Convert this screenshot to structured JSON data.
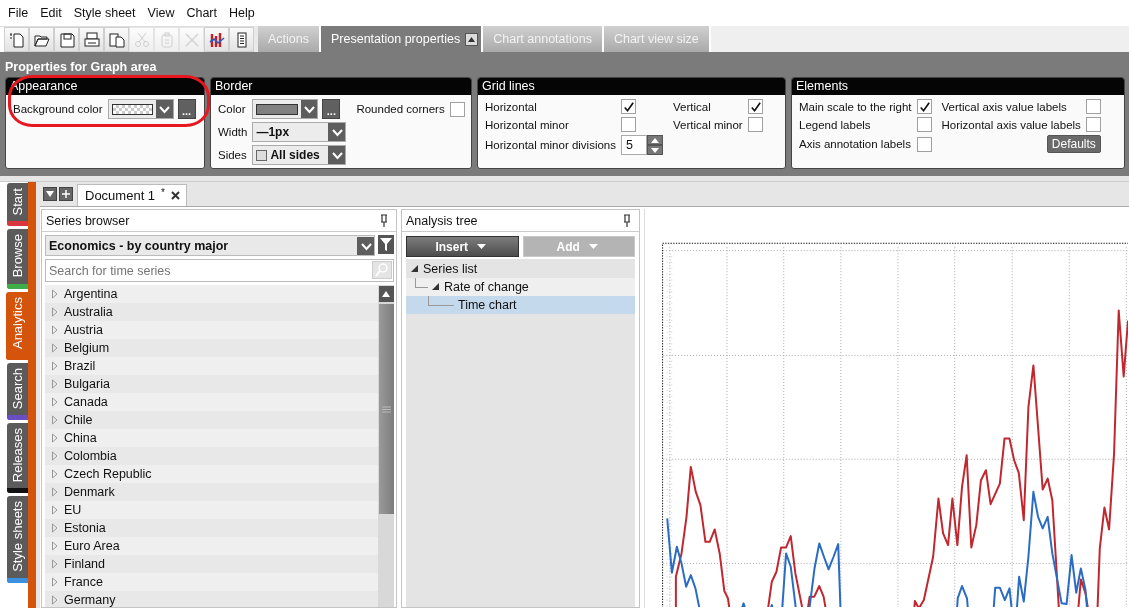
{
  "menu": [
    {
      "label": "File"
    },
    {
      "label": "Edit"
    },
    {
      "label": "Style sheet"
    },
    {
      "label": "View"
    },
    {
      "label": "Chart"
    },
    {
      "label": "Help"
    }
  ],
  "toolbar": {
    "tools": [
      {
        "kind": "new",
        "disabled": false
      },
      {
        "kind": "open",
        "disabled": false
      },
      {
        "kind": "save",
        "disabled": false
      },
      {
        "kind": "print",
        "disabled": false
      },
      {
        "kind": "copy",
        "disabled": false
      },
      {
        "kind": "cut",
        "disabled": true
      },
      {
        "kind": "paste",
        "disabled": true
      },
      {
        "kind": "delete",
        "disabled": true
      },
      {
        "kind": "chart",
        "disabled": false
      },
      {
        "kind": "list",
        "disabled": false
      }
    ],
    "tabs": [
      {
        "label": "Actions",
        "selected": false
      },
      {
        "label": "Presentation properties",
        "selected": true
      },
      {
        "label": "Chart annotations",
        "selected": false
      },
      {
        "label": "Chart view size",
        "selected": false
      }
    ]
  },
  "properties": {
    "title": "Properties for Graph area",
    "groups": [
      {
        "title": "Appearance",
        "highlighted": true,
        "rows": [
          [
            {
              "kind": "color",
              "label": "Background color",
              "transparent": true,
              "more": "..."
            }
          ]
        ]
      },
      {
        "title": "Border",
        "highlighted": false,
        "rows": [
          [
            {
              "kind": "color",
              "label": "Color",
              "transparent": false,
              "color": "#808080",
              "more": "..."
            },
            {
              "kind": "checkbox",
              "label": "Rounded corners",
              "checked": false
            }
          ],
          [
            {
              "kind": "dropdown",
              "label": "Width",
              "value": "—1px"
            }
          ],
          [
            {
              "kind": "sides_dropdown",
              "label": "Sides",
              "value": "All sides"
            }
          ]
        ]
      },
      {
        "title": "Grid lines",
        "highlighted": false,
        "rows": [
          [
            {
              "kind": "checkbox",
              "label": "Horizontal",
              "checked": true
            },
            {
              "kind": "checkbox",
              "label": "Vertical",
              "checked": true
            }
          ],
          [
            {
              "kind": "checkbox",
              "label": "Horizontal minor",
              "checked": false
            },
            {
              "kind": "checkbox",
              "label": "Vertical minor",
              "checked": false
            }
          ],
          [
            {
              "kind": "spinner",
              "label": "Horizontal minor divisions",
              "value": "5"
            }
          ]
        ]
      },
      {
        "title": "Elements",
        "highlighted": false,
        "rows": [
          [
            {
              "kind": "checkbox",
              "label": "Main scale to the right",
              "checked": true
            },
            {
              "kind": "checkbox",
              "label": "Vertical axis value labels",
              "checked": false
            }
          ],
          [
            {
              "kind": "checkbox",
              "label": "Legend labels",
              "checked": false
            },
            {
              "kind": "checkbox",
              "label": "Horizontal axis value labels",
              "checked": false
            }
          ],
          [
            {
              "kind": "checkbox",
              "label": "Axis annotation labels",
              "checked": false
            },
            {
              "kind": "button",
              "label": "Defaults"
            }
          ]
        ]
      }
    ]
  },
  "side_tabs": [
    {
      "label": "Start",
      "selected": false,
      "color": "#d9363e"
    },
    {
      "label": "Browse",
      "selected": false,
      "color": "#3fae49"
    },
    {
      "label": "Analytics",
      "selected": true,
      "color": "#d4540c"
    },
    {
      "label": "Search",
      "selected": false,
      "color": "#6a4fc4"
    },
    {
      "label": "Releases",
      "selected": false,
      "color": "#111111"
    },
    {
      "label": "Style sheets",
      "selected": false,
      "color": "#3d8fe0"
    }
  ],
  "document_tabs": [
    {
      "label": "Document 1",
      "modified": "*",
      "selected": true
    }
  ],
  "series_browser": {
    "title": "Series browser",
    "source": "Economics - by country major",
    "search": {
      "placeholder": "Search for time series"
    },
    "items": [
      {
        "label": "Argentina",
        "expanded": false
      },
      {
        "label": "Australia",
        "expanded": false
      },
      {
        "label": "Austria",
        "expanded": false
      },
      {
        "label": "Belgium",
        "expanded": false
      },
      {
        "label": "Brazil",
        "expanded": false
      },
      {
        "label": "Bulgaria",
        "expanded": false
      },
      {
        "label": "Canada",
        "expanded": false
      },
      {
        "label": "Chile",
        "expanded": false
      },
      {
        "label": "China",
        "expanded": false
      },
      {
        "label": "Colombia",
        "expanded": false
      },
      {
        "label": "Czech Republic",
        "expanded": false
      },
      {
        "label": "Denmark",
        "expanded": false
      },
      {
        "label": "EU",
        "expanded": false
      },
      {
        "label": "Estonia",
        "expanded": false
      },
      {
        "label": "Euro Area",
        "expanded": false
      },
      {
        "label": "Finland",
        "expanded": false
      },
      {
        "label": "France",
        "expanded": false
      },
      {
        "label": "Germany",
        "expanded": false
      }
    ]
  },
  "analysis_tree": {
    "title": "Analysis tree",
    "buttons": [
      {
        "label": "Insert",
        "disabled": false
      },
      {
        "label": "Add",
        "disabled": true
      }
    ],
    "items": [
      {
        "label": "Series list",
        "expanded": true,
        "selected": false,
        "children": [
          {
            "label": "Rate of change",
            "expanded": true,
            "selected": false,
            "children": [
              {
                "label": "Time chart",
                "selected": true
              }
            ]
          }
        ]
      }
    ]
  }
}
